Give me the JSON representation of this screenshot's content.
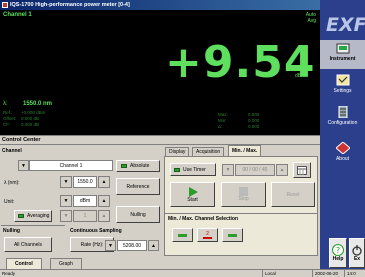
{
  "window": {
    "title": "IQS-1700 High-performance power meter [0-4]"
  },
  "display": {
    "channel_label": "Channel 1",
    "auto_label": "Auto",
    "auto_sub": "Avg",
    "reading": "+9.54",
    "unit": "dBm",
    "lambda_label": "λ:",
    "lambda_value": "1550.0 nm",
    "stats_left": [
      {
        "label": "Ref.:",
        "value": "+0.000 dBm"
      },
      {
        "label": "Offset:",
        "value": "0.000 dB"
      },
      {
        "label": "CF:",
        "value": "0.000 dB"
      }
    ],
    "stats_right": [
      {
        "label": "Max:",
        "value": "0.000"
      },
      {
        "label": "Min:",
        "value": "0.000"
      },
      {
        "label": "Δ:",
        "value": "0.000"
      }
    ]
  },
  "control_center": {
    "title": "Control Center",
    "channel_group": "Channel",
    "channel_select": "Channel 1",
    "absolute_label": "Absolute",
    "lambda_field_label": "λ (nm):",
    "lambda_field_value": "1550.0",
    "reference_button": "Reference",
    "unit_label": "Unit:",
    "unit_value": "dBm",
    "averaging_label": "Averaging",
    "averaging_value": "1",
    "nulling_button": "Nulling",
    "nulling_group": "Nulling",
    "all_channels_button": "All Channels",
    "continuous_group": "Continuous Sampling",
    "rate_label": "Rate (Hz):",
    "rate_value": "5208.00"
  },
  "right_panel": {
    "tabs": [
      "Display",
      "Acquisition",
      "Min. / Max."
    ],
    "active_tab": "Min. / Max.",
    "use_timer_label": "Use Timer",
    "timer_value": "00 / 00 / 45",
    "start_label": "Start",
    "stop_label": "Stop",
    "reset_label": "Reset",
    "channel_selection_title": "Min. / Max. Channel Selection",
    "channel_buttons": [
      "",
      "2",
      ""
    ]
  },
  "bottom_tabs": [
    "Control",
    "Graph"
  ],
  "active_bottom_tab": "Control",
  "sidebar": {
    "brand": "EXFO",
    "items": [
      {
        "label": "Instrument",
        "icon": "instrument-icon",
        "active": true
      },
      {
        "label": "Settings",
        "icon": "settings-icon",
        "active": false
      },
      {
        "label": "Configuration",
        "icon": "configuration-icon",
        "active": false
      },
      {
        "label": "About",
        "icon": "about-icon",
        "active": false
      }
    ],
    "help_label": "Help",
    "exit_label": "Ex"
  },
  "statusbar": {
    "status": "Ready",
    "mode": "Local",
    "date": "2002-06-20",
    "time": "14:0"
  }
}
